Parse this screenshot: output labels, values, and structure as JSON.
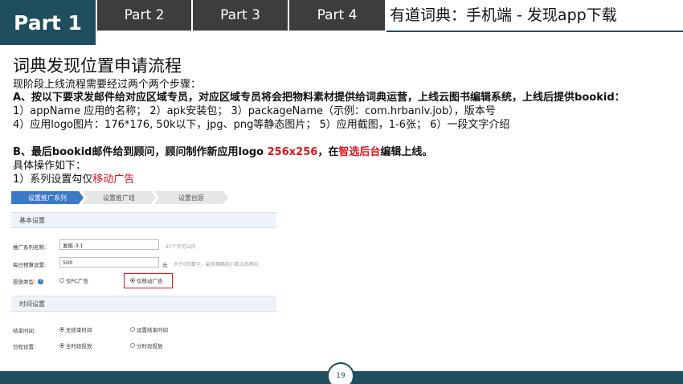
{
  "header": {
    "tabs": [
      {
        "label": "Part 1",
        "active": true
      },
      {
        "label": "Part 2"
      },
      {
        "label": "Part 3"
      },
      {
        "label": "Part 4"
      }
    ],
    "title": "有道词典：手机端 - 发现app下载",
    "accent_color": "#1f4e5e",
    "tab_color": "#3d3d3d"
  },
  "page_title": "词典发现位置申请流程",
  "intro": "现阶段上线流程需要经过两个两个步骤：",
  "step_a": "A、按以下要求发邮件给对应区域专员，对应区域专员将会把物料素材提供给词典运营，上线云图书编辑系统，上线后提供bookid：",
  "req_line1": "1）appName 应用的名称；  2）apk安装包；  3）packageName（示例：com.hrbanlv.job），版本号",
  "req_line2": "4）应用logo图片：176*176, 50k以下，jpg、png等静态图片；  5）应用截图，1-6张；   6）一段文字介绍",
  "step_b": {
    "prefix": "B、最后bookid邮件给到顾问，顾问制作新应用logo ",
    "size": "256x256",
    "mid": "，在",
    "platform": "智选后台",
    "suffix": "编辑上线。"
  },
  "ops_label": "具体操作如下：",
  "ops_step1": {
    "prefix": "1）系列设置勾仅",
    "highlight": "移动广告"
  },
  "panel": {
    "steps": [
      "设置推广系列",
      "设置推广组",
      "设置创意"
    ],
    "basic_section": "基本设置",
    "series_name_label": "推广系列名称:",
    "series_name_value": "发现-3.1",
    "series_name_hint": "25个字符以内",
    "budget_label": "每日预算设置:",
    "budget_value": "500",
    "budget_unit": "元",
    "budget_hint": "大于0的数字，最多精确到小数点后两位",
    "type_label": "投放类型:",
    "type_help": "?",
    "type_pc": "仅PC广告",
    "type_mobile": "仅移动广告",
    "time_section": "时间设置",
    "end_label": "结束时间:",
    "end_none": "无结束时间",
    "end_set": "设置结束时间",
    "schedule_label": "日程设置:",
    "schedule_all": "全时段投放",
    "schedule_part": "分时段投放"
  },
  "page_number": "19"
}
